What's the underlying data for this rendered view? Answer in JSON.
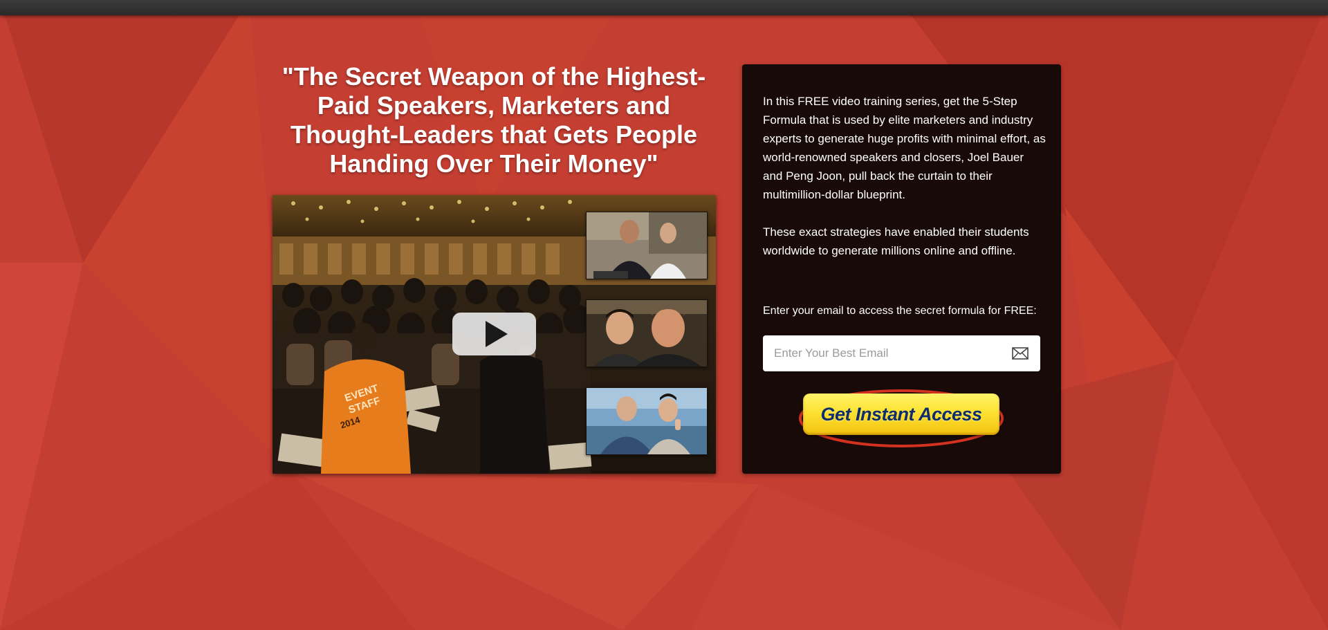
{
  "headline": "\"The Secret Weapon of the Highest-Paid Speakers, Marketers and Thought-Leaders that Gets People Handing Over Their Money\"",
  "video": {
    "event_shirt_lines": [
      "EVENT",
      "STAFF",
      "2014"
    ]
  },
  "panel": {
    "paragraphs": [
      "In this FREE video training series, get the 5-Step Formula that is used by elite marketers and industry experts to generate huge profits with minimal effort, as world-renowned speakers and closers, Joel Bauer and Peng Joon, pull back the curtain to their multimillion-dollar blueprint.",
      "These exact strategies have enabled their students worldwide to generate millions online and offline."
    ],
    "email_prompt": "Enter your email to access the secret formula for FREE:",
    "email_placeholder": "Enter Your Best Email",
    "email_icon": "envelope-icon",
    "cta_label": "Get Instant Access"
  },
  "colors": {
    "background": "#c63f33",
    "panel": "#180a08",
    "cta_yellow": "#fde233",
    "cta_text": "#0f2e69"
  }
}
